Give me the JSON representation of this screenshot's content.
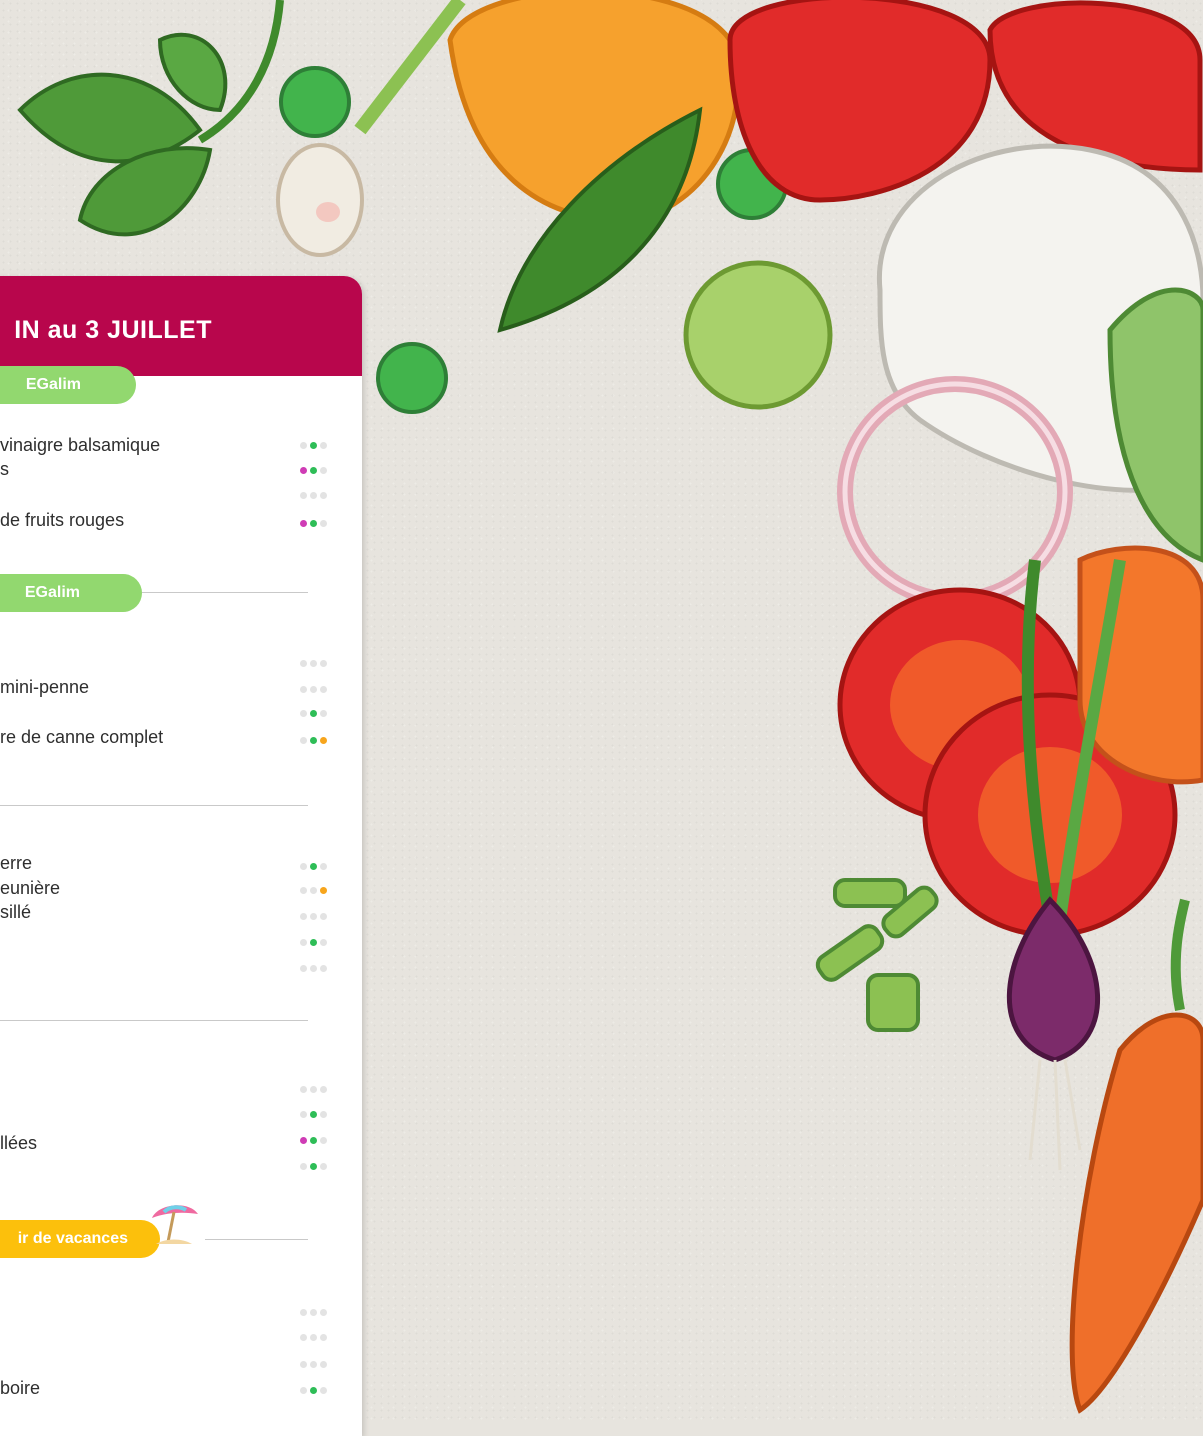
{
  "header": {
    "title": "IN au 3 JUILLET"
  },
  "badges": {
    "egalim_1": "EGalim",
    "egalim_2": "EGalim",
    "vacances": "ir de vacances"
  },
  "colors": {
    "header": "#b8064c",
    "egalim": "#92d86f",
    "vacances": "#fcc00c",
    "dot_green": "#2ebd57",
    "dot_purple": "#cf3cb5",
    "dot_orange": "#f7a51c"
  },
  "menu_lines": [
    "vinaigre balsamique",
    "s",
    "de fruits rouges",
    "mini-penne",
    "re de canne complet",
    "erre",
    "eunière",
    "sillé",
    "llées",
    "boire"
  ],
  "dot_patterns": [
    [
      "off",
      "g",
      "off"
    ],
    [
      "p",
      "g",
      "off"
    ],
    [
      "off",
      "off",
      "off"
    ],
    [
      "p",
      "g",
      "off"
    ],
    [
      "off",
      "off",
      "off"
    ],
    [
      "off",
      "off",
      "off"
    ],
    [
      "off",
      "g",
      "off"
    ],
    [
      "off",
      "g",
      "o"
    ],
    [
      "off",
      "g",
      "off"
    ],
    [
      "off",
      "off",
      "o"
    ],
    [
      "off",
      "off",
      "off"
    ],
    [
      "off",
      "g",
      "off"
    ],
    [
      "off",
      "off",
      "off"
    ],
    [
      "off",
      "off",
      "off"
    ],
    [
      "off",
      "g",
      "off"
    ],
    [
      "p",
      "g",
      "off"
    ],
    [
      "off",
      "g",
      "off"
    ],
    [
      "off",
      "off",
      "off"
    ],
    [
      "off",
      "off",
      "off"
    ],
    [
      "off",
      "off",
      "off"
    ],
    [
      "off",
      "g",
      "off"
    ]
  ]
}
